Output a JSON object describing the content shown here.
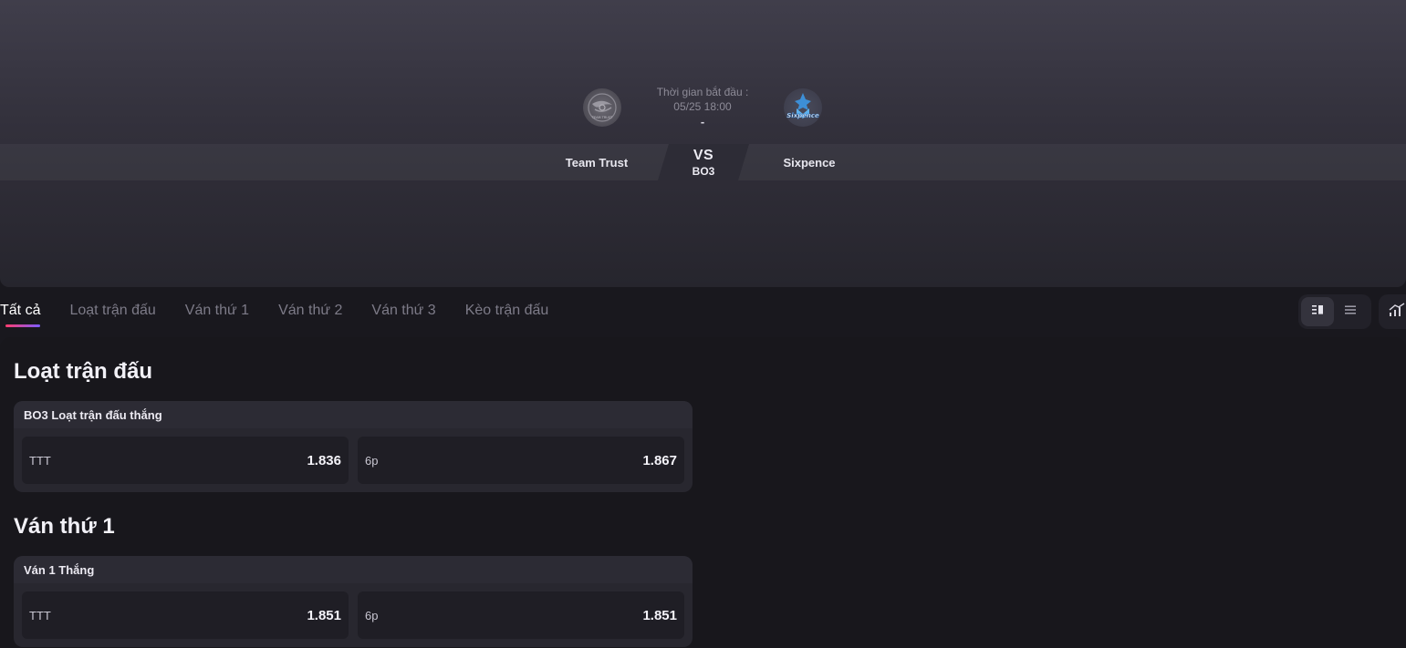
{
  "match": {
    "start_label": "Thời gian bắt đầu :",
    "start_time": "05/25 18:00",
    "score": "-",
    "vs": "VS",
    "format": "BO3",
    "team_left": "Team Trust",
    "team_right": "Sixpence",
    "team_left_logo_text": "TEAM TRUST",
    "team_right_logo_text": "Sixpence"
  },
  "tabs": [
    {
      "label": "Tất cả"
    },
    {
      "label": "Loạt trận đấu"
    },
    {
      "label": "Ván thứ 1"
    },
    {
      "label": "Ván thứ 2"
    },
    {
      "label": "Ván thứ 3"
    },
    {
      "label": "Kèo trận đấu"
    }
  ],
  "sections": [
    {
      "title": "Loạt trận đấu",
      "market": {
        "name": "BO3 Loạt trận đấu thắng",
        "odds": [
          {
            "name": "TTT",
            "value": "1.836"
          },
          {
            "name": "6p",
            "value": "1.867"
          }
        ]
      }
    },
    {
      "title": "Ván thứ 1",
      "market": {
        "name": "Ván 1 Thắng",
        "odds": [
          {
            "name": "TTT",
            "value": "1.851"
          },
          {
            "name": "6p",
            "value": "1.851"
          }
        ]
      }
    }
  ],
  "colors": {
    "accent_gradient_start": "#ff3d6e",
    "accent_gradient_end": "#7b5cff",
    "background": "#19181e"
  },
  "icons": [
    "team-trust-logo",
    "sixpence-logo",
    "grid-view-icon",
    "list-view-icon",
    "stats-chart-icon"
  ]
}
